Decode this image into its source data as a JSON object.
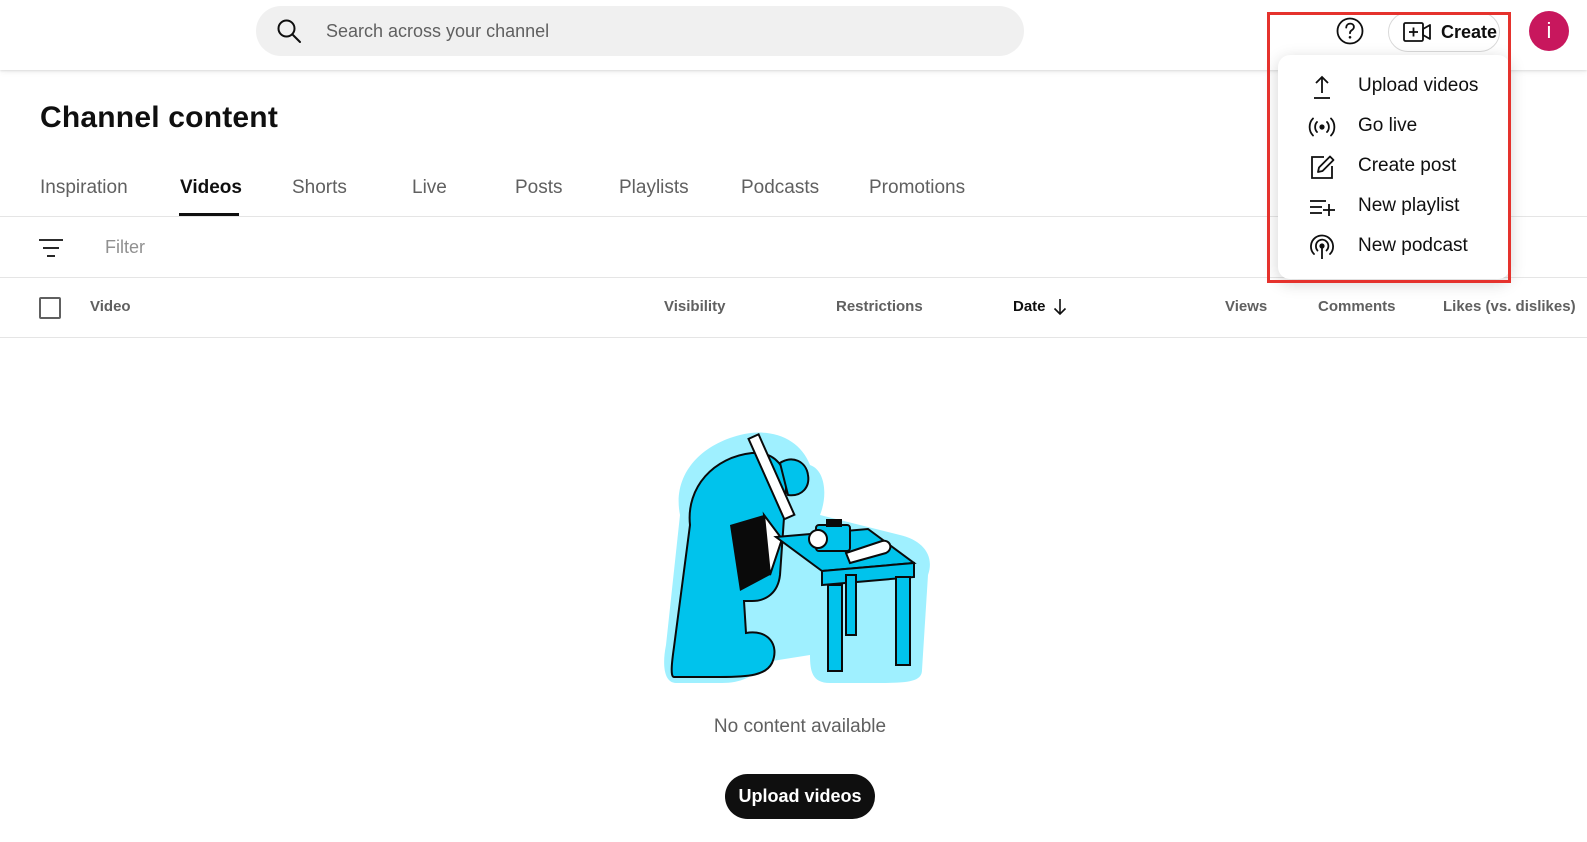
{
  "header": {
    "search": {
      "placeholder": "Search across your channel",
      "value": ""
    },
    "create_label": "Create",
    "avatar_letter": "i"
  },
  "page": {
    "title": "Channel content"
  },
  "tabs": [
    {
      "label": "Inspiration",
      "active": false
    },
    {
      "label": "Videos",
      "active": true
    },
    {
      "label": "Shorts",
      "active": false
    },
    {
      "label": "Live",
      "active": false
    },
    {
      "label": "Posts",
      "active": false
    },
    {
      "label": "Playlists",
      "active": false
    },
    {
      "label": "Podcasts",
      "active": false
    },
    {
      "label": "Promotions",
      "active": false
    }
  ],
  "filter": {
    "placeholder": "Filter"
  },
  "table": {
    "columns": [
      "Video",
      "Visibility",
      "Restrictions",
      "Date",
      "Views",
      "Comments",
      "Likes (vs. dislikes)"
    ],
    "sort_column": "Date",
    "sort_direction": "descending"
  },
  "empty_state": {
    "message": "No content available",
    "button_label": "Upload videos"
  },
  "create_menu": {
    "items": [
      {
        "label": "Upload videos",
        "icon": "upload-icon"
      },
      {
        "label": "Go live",
        "icon": "live-broadcast-icon"
      },
      {
        "label": "Create post",
        "icon": "edit-post-icon"
      },
      {
        "label": "New playlist",
        "icon": "playlist-add-icon"
      },
      {
        "label": "New podcast",
        "icon": "podcast-icon"
      }
    ]
  },
  "colors": {
    "avatar": "#c8175d",
    "highlight": "#e5322d",
    "illustration": "#00c3ec",
    "primary_button": "#0f0f0f"
  }
}
